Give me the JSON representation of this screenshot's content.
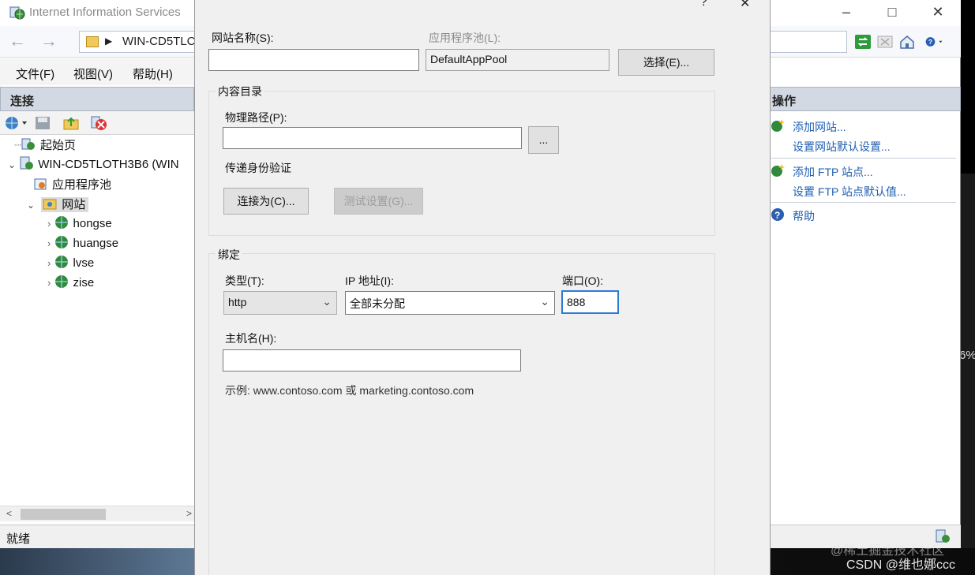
{
  "iis": {
    "title": "Internet Information Services",
    "address": "WIN-CD5TLC",
    "menu": [
      "文件(F)",
      "视图(V)",
      "帮助(H)"
    ],
    "connections_title": "连接",
    "tree": [
      {
        "label": "起始页"
      },
      {
        "label": "WIN-CD5TLOTH3B6 (WIN"
      },
      {
        "label": "应用程序池"
      },
      {
        "label": "网站"
      },
      {
        "label": "hongse"
      },
      {
        "label": "huangse"
      },
      {
        "label": "lvse"
      },
      {
        "label": "zise"
      }
    ],
    "status": "就绪",
    "actions_title": "操作",
    "actions": [
      "添加网站...",
      "设置网站默认设置...",
      "添加 FTP 站点...",
      "设置 FTP 站点默认值...",
      "帮助"
    ]
  },
  "dialog": {
    "site_name_label": "网站名称(S):",
    "site_name_value": "",
    "app_pool_label": "应用程序池(L):",
    "app_pool_value": "DefaultAppPool",
    "select_button": "选择(E)...",
    "content_dir_title": "内容目录",
    "physical_path_label": "物理路径(P):",
    "physical_path_value": "",
    "browse_button": "...",
    "pass_auth_label": "传递身份验证",
    "connect_as_button": "连接为(C)...",
    "test_settings_button": "测试设置(G)...",
    "binding_title": "绑定",
    "type_label": "类型(T):",
    "type_value": "http",
    "ip_label": "IP 地址(I):",
    "ip_value": "全部未分配",
    "port_label": "端口(O):",
    "port_value": "888",
    "host_label": "主机名(H):",
    "host_value": "",
    "example": "示例: www.contoso.com 或 marketing.contoso.com"
  },
  "overlay": {
    "percent_fragment": "6%",
    "watermark1": "@稀土掘金技术社区",
    "watermark2": "CSDN @维也娜ccc"
  }
}
